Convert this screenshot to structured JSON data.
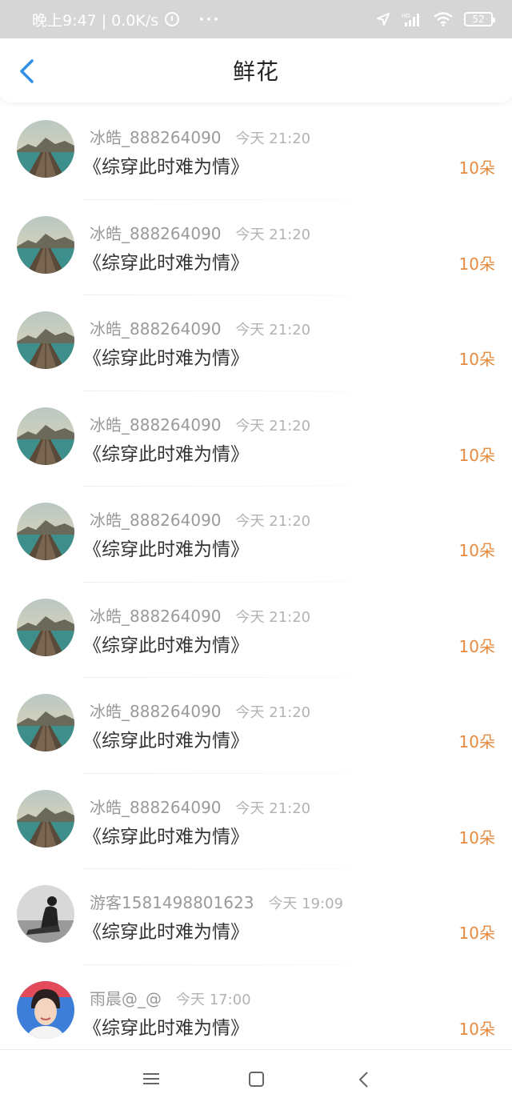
{
  "status_bar": {
    "time": "晚上9:47 | 0.0K/s",
    "more": "···",
    "signal_label": "HD",
    "battery": "52"
  },
  "header": {
    "title": "鲜花"
  },
  "items": [
    {
      "username": "冰皓_888264090",
      "time": "今天 21:20",
      "title": "《综穿此时难为情》",
      "count": "10朵",
      "avatar": "landscape"
    },
    {
      "username": "冰皓_888264090",
      "time": "今天 21:20",
      "title": "《综穿此时难为情》",
      "count": "10朵",
      "avatar": "landscape"
    },
    {
      "username": "冰皓_888264090",
      "time": "今天 21:20",
      "title": "《综穿此时难为情》",
      "count": "10朵",
      "avatar": "landscape"
    },
    {
      "username": "冰皓_888264090",
      "time": "今天 21:20",
      "title": "《综穿此时难为情》",
      "count": "10朵",
      "avatar": "landscape"
    },
    {
      "username": "冰皓_888264090",
      "time": "今天 21:20",
      "title": "《综穿此时难为情》",
      "count": "10朵",
      "avatar": "landscape"
    },
    {
      "username": "冰皓_888264090",
      "time": "今天 21:20",
      "title": "《综穿此时难为情》",
      "count": "10朵",
      "avatar": "landscape"
    },
    {
      "username": "冰皓_888264090",
      "time": "今天 21:20",
      "title": "《综穿此时难为情》",
      "count": "10朵",
      "avatar": "landscape"
    },
    {
      "username": "冰皓_888264090",
      "time": "今天 21:20",
      "title": "《综穿此时难为情》",
      "count": "10朵",
      "avatar": "landscape"
    },
    {
      "username": "游客1581498801623",
      "time": "今天 19:09",
      "title": "《综穿此时难为情》",
      "count": "10朵",
      "avatar": "monochrome-figure"
    },
    {
      "username": "雨晨@_@",
      "time": "今天 17:00",
      "title": "《综穿此时难为情》",
      "count": "10朵",
      "avatar": "portrait"
    }
  ],
  "colors": {
    "accent": "#2f8ee6",
    "flower_count": "#e58a3e",
    "status_bar_bg": "#d6d6d6"
  },
  "nav": {
    "menu_icon": "menu-icon",
    "home_icon": "square-home-icon",
    "back_icon": "chevron-back-icon"
  }
}
